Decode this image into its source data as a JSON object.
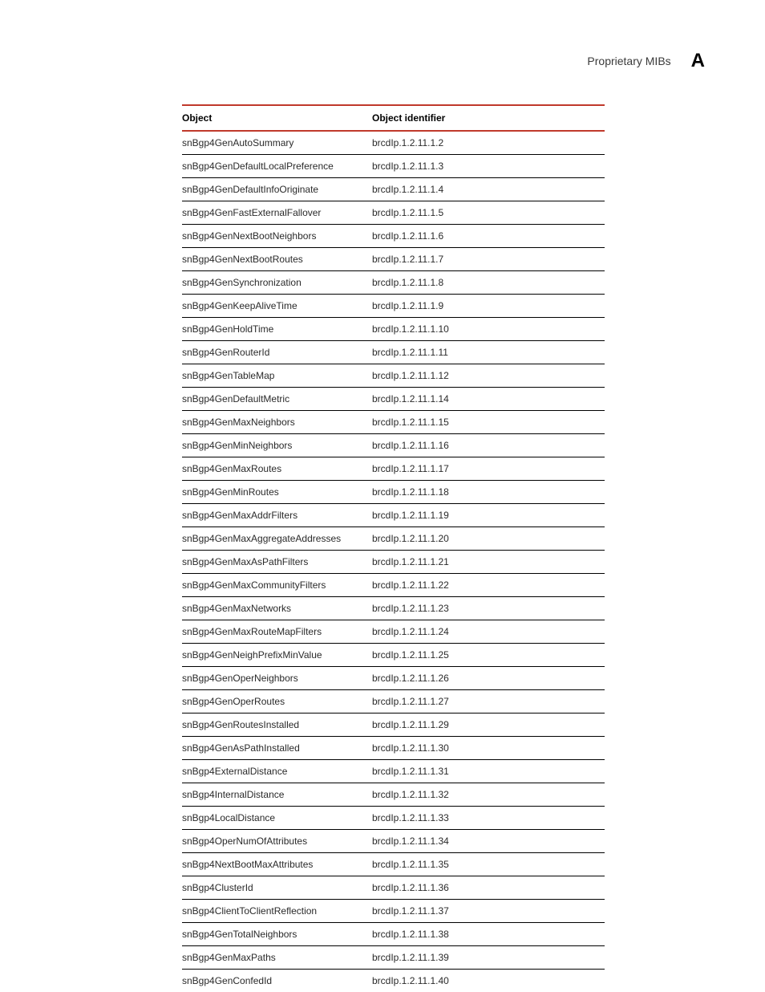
{
  "header": {
    "section_title": "Proprietary MIBs",
    "appendix_letter": "A"
  },
  "table": {
    "headers": {
      "object": "Object",
      "identifier": "Object identifier"
    },
    "rows": [
      {
        "object": "snBgp4GenAutoSummary",
        "identifier": "brcdIp.1.2.11.1.2"
      },
      {
        "object": "snBgp4GenDefaultLocalPreference",
        "identifier": "brcdIp.1.2.11.1.3"
      },
      {
        "object": "snBgp4GenDefaultInfoOriginate",
        "identifier": "brcdIp.1.2.11.1.4"
      },
      {
        "object": "snBgp4GenFastExternalFallover",
        "identifier": "brcdIp.1.2.11.1.5"
      },
      {
        "object": "snBgp4GenNextBootNeighbors",
        "identifier": "brcdIp.1.2.11.1.6"
      },
      {
        "object": "snBgp4GenNextBootRoutes",
        "identifier": "brcdIp.1.2.11.1.7"
      },
      {
        "object": "snBgp4GenSynchronization",
        "identifier": "brcdIp.1.2.11.1.8"
      },
      {
        "object": "snBgp4GenKeepAliveTime",
        "identifier": "brcdIp.1.2.11.1.9"
      },
      {
        "object": "snBgp4GenHoldTime",
        "identifier": "brcdIp.1.2.11.1.10"
      },
      {
        "object": "snBgp4GenRouterId",
        "identifier": "brcdIp.1.2.11.1.11"
      },
      {
        "object": "snBgp4GenTableMap",
        "identifier": "brcdIp.1.2.11.1.12"
      },
      {
        "object": "snBgp4GenDefaultMetric",
        "identifier": "brcdIp.1.2.11.1.14"
      },
      {
        "object": "snBgp4GenMaxNeighbors",
        "identifier": "brcdIp.1.2.11.1.15"
      },
      {
        "object": "snBgp4GenMinNeighbors",
        "identifier": "brcdIp.1.2.11.1.16"
      },
      {
        "object": "snBgp4GenMaxRoutes",
        "identifier": "brcdIp.1.2.11.1.17"
      },
      {
        "object": "snBgp4GenMinRoutes",
        "identifier": "brcdIp.1.2.11.1.18"
      },
      {
        "object": "snBgp4GenMaxAddrFilters",
        "identifier": "brcdIp.1.2.11.1.19"
      },
      {
        "object": "snBgp4GenMaxAggregateAddresses",
        "identifier": "brcdIp.1.2.11.1.20"
      },
      {
        "object": "snBgp4GenMaxAsPathFilters",
        "identifier": "brcdIp.1.2.11.1.21"
      },
      {
        "object": "snBgp4GenMaxCommunityFilters",
        "identifier": "brcdIp.1.2.11.1.22"
      },
      {
        "object": "snBgp4GenMaxNetworks",
        "identifier": "brcdIp.1.2.11.1.23"
      },
      {
        "object": "snBgp4GenMaxRouteMapFilters",
        "identifier": "brcdIp.1.2.11.1.24"
      },
      {
        "object": "snBgp4GenNeighPrefixMinValue",
        "identifier": "brcdIp.1.2.11.1.25"
      },
      {
        "object": "snBgp4GenOperNeighbors",
        "identifier": "brcdIp.1.2.11.1.26"
      },
      {
        "object": "snBgp4GenOperRoutes",
        "identifier": "brcdIp.1.2.11.1.27"
      },
      {
        "object": "snBgp4GenRoutesInstalled",
        "identifier": "brcdIp.1.2.11.1.29"
      },
      {
        "object": "snBgp4GenAsPathInstalled",
        "identifier": "brcdIp.1.2.11.1.30"
      },
      {
        "object": "snBgp4ExternalDistance",
        "identifier": "brcdIp.1.2.11.1.31"
      },
      {
        "object": "snBgp4InternalDistance",
        "identifier": "brcdIp.1.2.11.1.32"
      },
      {
        "object": "snBgp4LocalDistance",
        "identifier": "brcdIp.1.2.11.1.33"
      },
      {
        "object": "snBgp4OperNumOfAttributes",
        "identifier": "brcdIp.1.2.11.1.34"
      },
      {
        "object": "snBgp4NextBootMaxAttributes",
        "identifier": "brcdIp.1.2.11.1.35"
      },
      {
        "object": "snBgp4ClusterId",
        "identifier": "brcdIp.1.2.11.1.36"
      },
      {
        "object": "snBgp4ClientToClientReflection",
        "identifier": "brcdIp.1.2.11.1.37"
      },
      {
        "object": "snBgp4GenTotalNeighbors",
        "identifier": "brcdIp.1.2.11.1.38"
      },
      {
        "object": "snBgp4GenMaxPaths",
        "identifier": "brcdIp.1.2.11.1.39"
      },
      {
        "object": "snBgp4GenConfedId",
        "identifier": "brcdIp.1.2.11.1.40"
      }
    ]
  }
}
